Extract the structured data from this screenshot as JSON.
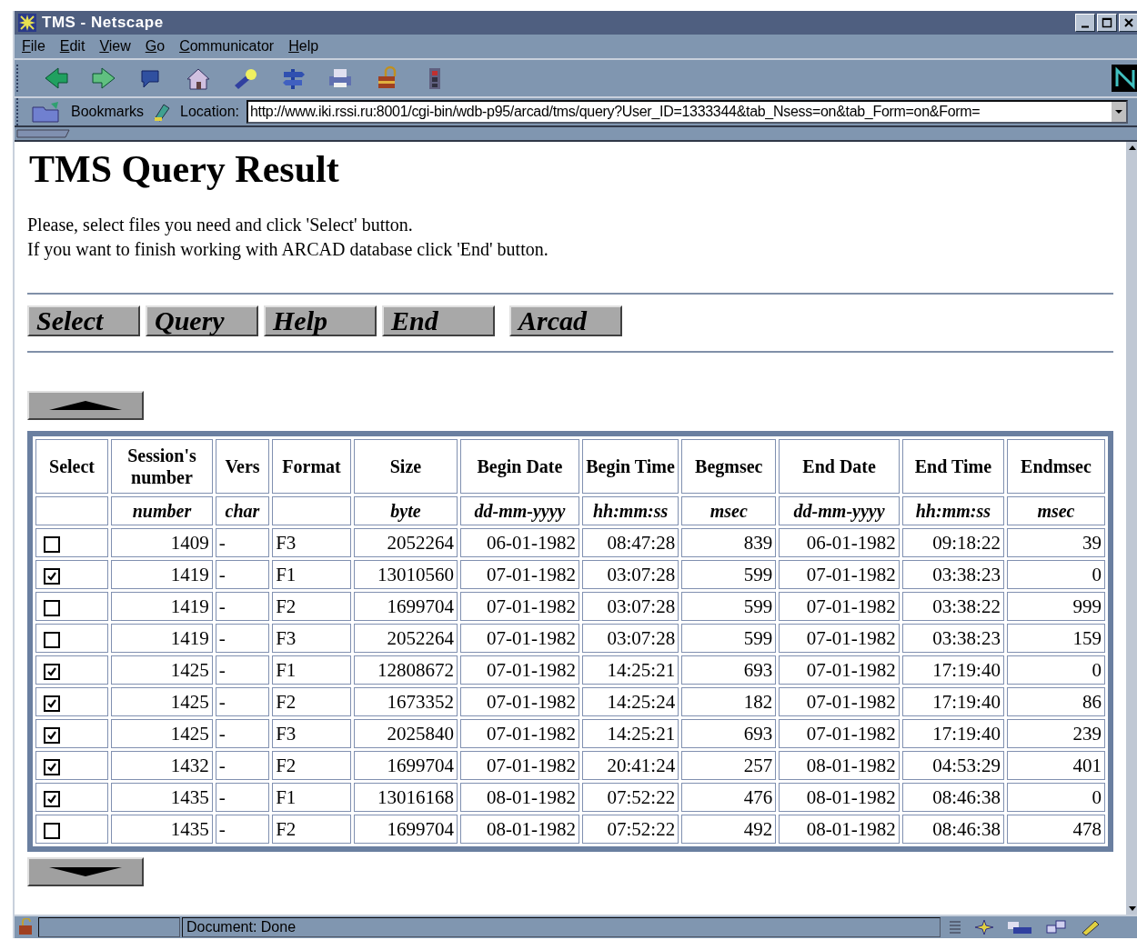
{
  "window": {
    "title": "TMS - Netscape"
  },
  "menu": [
    "File",
    "Edit",
    "View",
    "Go",
    "Communicator",
    "Help"
  ],
  "location": {
    "bookmarks_label": "Bookmarks",
    "label": "Location:",
    "url": "http://www.iki.rssi.ru:8001/cgi-bin/wdb-p95/arcad/tms/query?User_ID=1333344&tab_Nsess=on&tab_Form=on&Form="
  },
  "page": {
    "heading": "TMS Query Result",
    "instructions": [
      "Please, select files you need and click 'Select' button.",
      "If you want to finish working with ARCAD database click 'End' button."
    ],
    "buttons": [
      "Select",
      "Query",
      "Help",
      "End",
      "Arcad"
    ]
  },
  "table": {
    "columns": [
      {
        "name": "Select"
      },
      {
        "name": "Session's number",
        "unit": "number"
      },
      {
        "name": "Vers",
        "unit": "char"
      },
      {
        "name": "Format"
      },
      {
        "name": "Size",
        "unit": "byte"
      },
      {
        "name": "Begin Date",
        "unit": "dd-mm-yyyy"
      },
      {
        "name": "Begin Time",
        "unit": "hh:mm:ss"
      },
      {
        "name": "Begmsec",
        "unit": "msec"
      },
      {
        "name": "End Date",
        "unit": "dd-mm-yyyy"
      },
      {
        "name": "End Time",
        "unit": "hh:mm:ss"
      },
      {
        "name": "Endmsec",
        "unit": "msec"
      }
    ],
    "rows": [
      {
        "cells": [
          {
            "checked": false
          },
          "1409",
          "-",
          "F3",
          "2052264",
          "06-01-1982",
          "08:47:28",
          "839",
          "06-01-1982",
          "09:18:22",
          "39"
        ]
      },
      {
        "cells": [
          {
            "checked": true
          },
          "1419",
          "-",
          "F1",
          "13010560",
          "07-01-1982",
          "03:07:28",
          "599",
          "07-01-1982",
          "03:38:23",
          "0"
        ]
      },
      {
        "cells": [
          {
            "checked": false
          },
          "1419",
          "-",
          "F2",
          "1699704",
          "07-01-1982",
          "03:07:28",
          "599",
          "07-01-1982",
          "03:38:22",
          "999"
        ]
      },
      {
        "cells": [
          {
            "checked": false
          },
          "1419",
          "-",
          "F3",
          "2052264",
          "07-01-1982",
          "03:07:28",
          "599",
          "07-01-1982",
          "03:38:23",
          "159"
        ]
      },
      {
        "cells": [
          {
            "checked": true
          },
          "1425",
          "-",
          "F1",
          "12808672",
          "07-01-1982",
          "14:25:21",
          "693",
          "07-01-1982",
          "17:19:40",
          "0"
        ]
      },
      {
        "cells": [
          {
            "checked": true
          },
          "1425",
          "-",
          "F2",
          "1673352",
          "07-01-1982",
          "14:25:24",
          "182",
          "07-01-1982",
          "17:19:40",
          "86"
        ]
      },
      {
        "cells": [
          {
            "checked": true
          },
          "1425",
          "-",
          "F3",
          "2025840",
          "07-01-1982",
          "14:25:21",
          "693",
          "07-01-1982",
          "17:19:40",
          "239"
        ]
      },
      {
        "cells": [
          {
            "checked": true
          },
          "1432",
          "-",
          "F2",
          "1699704",
          "07-01-1982",
          "20:41:24",
          "257",
          "08-01-1982",
          "04:53:29",
          "401"
        ]
      },
      {
        "cells": [
          {
            "checked": true
          },
          "1435",
          "-",
          "F1",
          "13016168",
          "08-01-1982",
          "07:52:22",
          "476",
          "08-01-1982",
          "08:46:38",
          "0"
        ]
      },
      {
        "cells": [
          {
            "checked": false
          },
          "1435",
          "-",
          "F2",
          "1699704",
          "08-01-1982",
          "07:52:22",
          "492",
          "08-01-1982",
          "08:46:38",
          "478"
        ]
      }
    ]
  },
  "status_bar": {
    "text": "Document: Done"
  }
}
